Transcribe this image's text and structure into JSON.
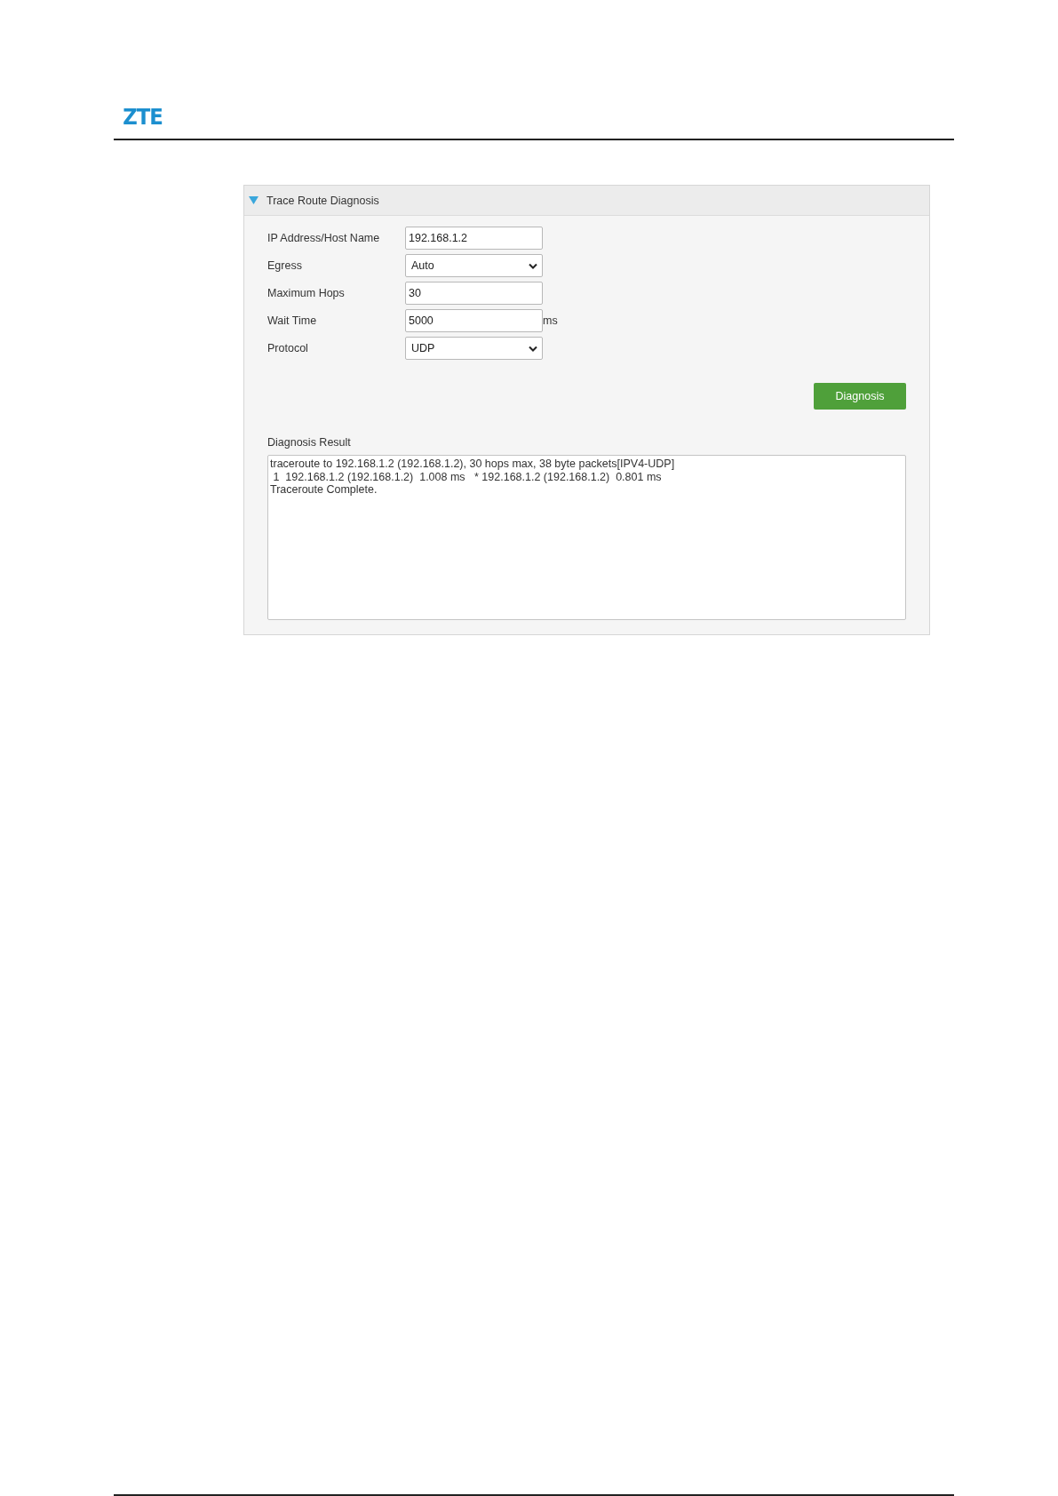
{
  "document_header": {
    "logo": "ZTE"
  },
  "panel": {
    "title": "Trace Route Diagnosis",
    "expanded": true,
    "fields": [
      {
        "kind": "text",
        "label": "IP Address/Host Name",
        "value": "192.168.1.2"
      },
      {
        "kind": "select",
        "label": "Egress",
        "value": "Auto"
      },
      {
        "kind": "text",
        "label": "Maximum Hops",
        "value": "30"
      },
      {
        "kind": "text",
        "label": "Wait Time",
        "value": "5000",
        "unit": "ms"
      },
      {
        "kind": "select",
        "label": "Protocol",
        "value": "UDP"
      }
    ],
    "button": "Diagnosis",
    "result_label": "Diagnosis Result",
    "result_lines": [
      "traceroute to 192.168.1.2 (192.168.1.2), 30 hops max, 38 byte packets[IPV4-UDP]",
      " 1  192.168.1.2 (192.168.1.2)  1.008 ms   * 192.168.1.2 (192.168.1.2)  0.801 ms",
      "Traceroute Complete."
    ]
  }
}
